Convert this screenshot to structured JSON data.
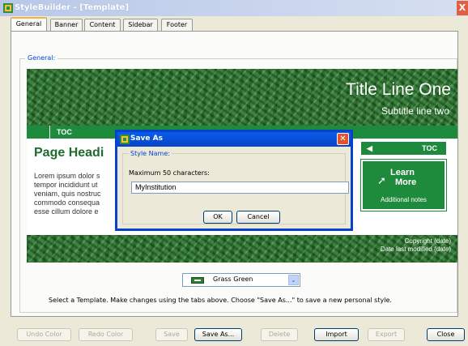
{
  "window": {
    "title": "StyleBuilder - [Template]",
    "close_glyph": "X"
  },
  "tabs": [
    {
      "label": "General",
      "active": true
    },
    {
      "label": "Banner",
      "active": false
    },
    {
      "label": "Content",
      "active": false
    },
    {
      "label": "Sidebar",
      "active": false
    },
    {
      "label": "Footer",
      "active": false
    }
  ],
  "general_group_label": "General:",
  "preview": {
    "title_line_one": "Title Line One",
    "subtitle_line_two": "Subtitle line two",
    "toc_left": "TOC",
    "toc_right": "TOC",
    "page_heading": "Page Headi",
    "lorem_lines": [
      "Lorem ipsum dolor s",
      "tempor incididunt ut",
      "veniam, quis nostruc",
      "commodo consequa",
      "esse cillum dolore e"
    ],
    "learn": "Learn",
    "more": "More",
    "additional_notes": "Additional notes",
    "copyright": "Copyright (date)",
    "date_modified": "Date last modified (date)",
    "theme_color": "#2e7d32"
  },
  "save_as_dialog": {
    "title": "Save As",
    "group_label": "Style Name:",
    "max_chars_label": "Maximum 50 characters:",
    "input_value": "MyInstitution",
    "ok_label": "OK",
    "cancel_label": "Cancel",
    "title_color": "#0a5ce8"
  },
  "template_select": {
    "value": "Grass Green",
    "icon": "swatch-icon"
  },
  "instruction": "Select a Template. Make changes using the tabs above. Choose \"Save As...\" to save a new personal style.",
  "buttons": {
    "undo_color": "Undo Color",
    "redo_color": "Redo Color",
    "save": "Save",
    "save_as": "Save As...",
    "delete": "Delete",
    "import": "Import",
    "export": "Export",
    "close": "Close"
  }
}
